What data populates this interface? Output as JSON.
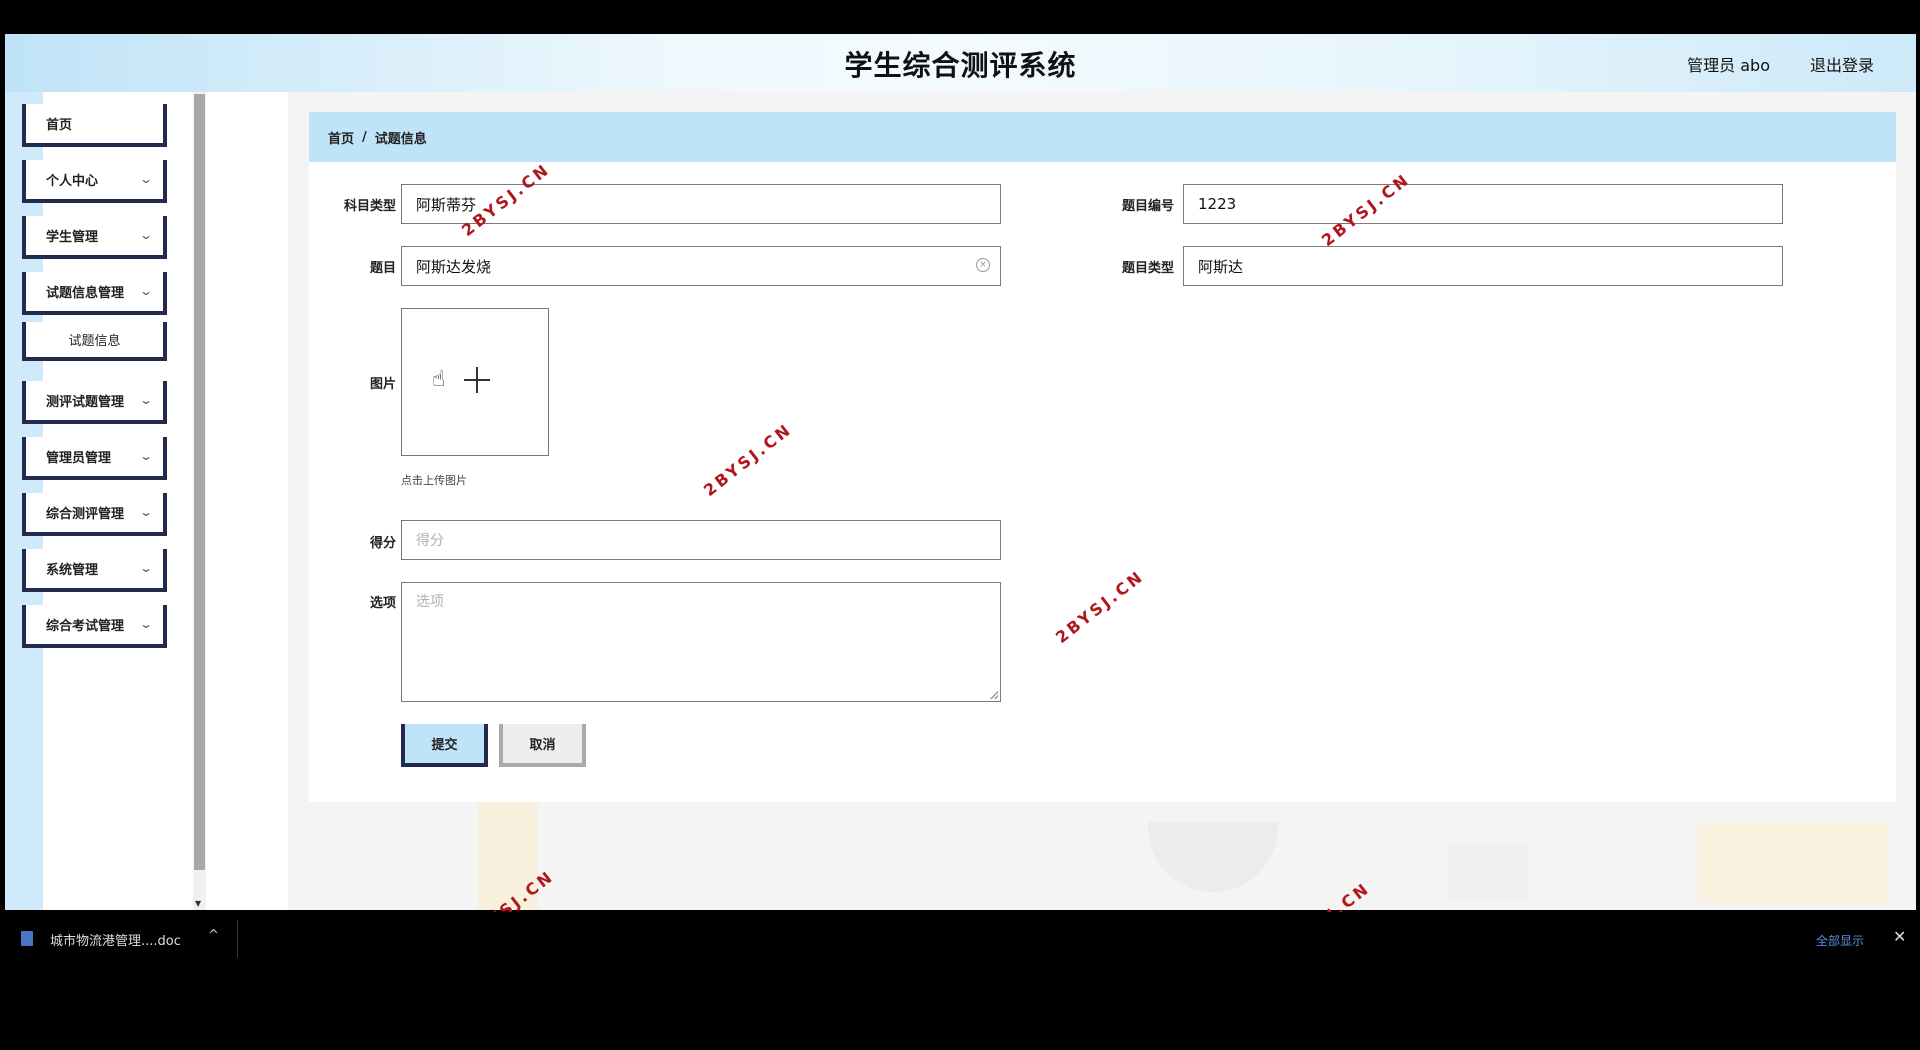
{
  "header": {
    "title": "学生综合测评系统",
    "user": "管理员 abo",
    "logout": "退出登录"
  },
  "sidebar": {
    "items": [
      {
        "label": "首页",
        "expandable": false
      },
      {
        "label": "个人中心",
        "expandable": true
      },
      {
        "label": "学生管理",
        "expandable": true
      },
      {
        "label": "试题信息管理",
        "expandable": true
      },
      {
        "label": "试题信息",
        "expandable": false,
        "sub": true
      },
      {
        "label": "测评试题管理",
        "expandable": true
      },
      {
        "label": "管理员管理",
        "expandable": true
      },
      {
        "label": "综合测评管理",
        "expandable": true
      },
      {
        "label": "系统管理",
        "expandable": true
      },
      {
        "label": "综合考试管理",
        "expandable": true
      }
    ]
  },
  "breadcrumb": {
    "home": "首页",
    "separator": "/",
    "current": "试题信息"
  },
  "form": {
    "subject_type": {
      "label": "科目类型",
      "value": "阿斯蒂芬"
    },
    "question_no": {
      "label": "题目编号",
      "value": "1223"
    },
    "question": {
      "label": "题目",
      "value": "阿斯达发烧"
    },
    "question_type": {
      "label": "题目类型",
      "value": "阿斯达"
    },
    "image": {
      "label": "图片",
      "hint": "点击上传图片"
    },
    "score": {
      "label": "得分",
      "placeholder": "得分"
    },
    "options": {
      "label": "选项",
      "placeholder": "选项"
    },
    "submit": "提交",
    "cancel": "取消"
  },
  "watermark": "2BYSJ.CN",
  "taskbar": {
    "download_name": "城市物流港管理....doc",
    "show_all": "全部显示",
    "close": "✕"
  }
}
